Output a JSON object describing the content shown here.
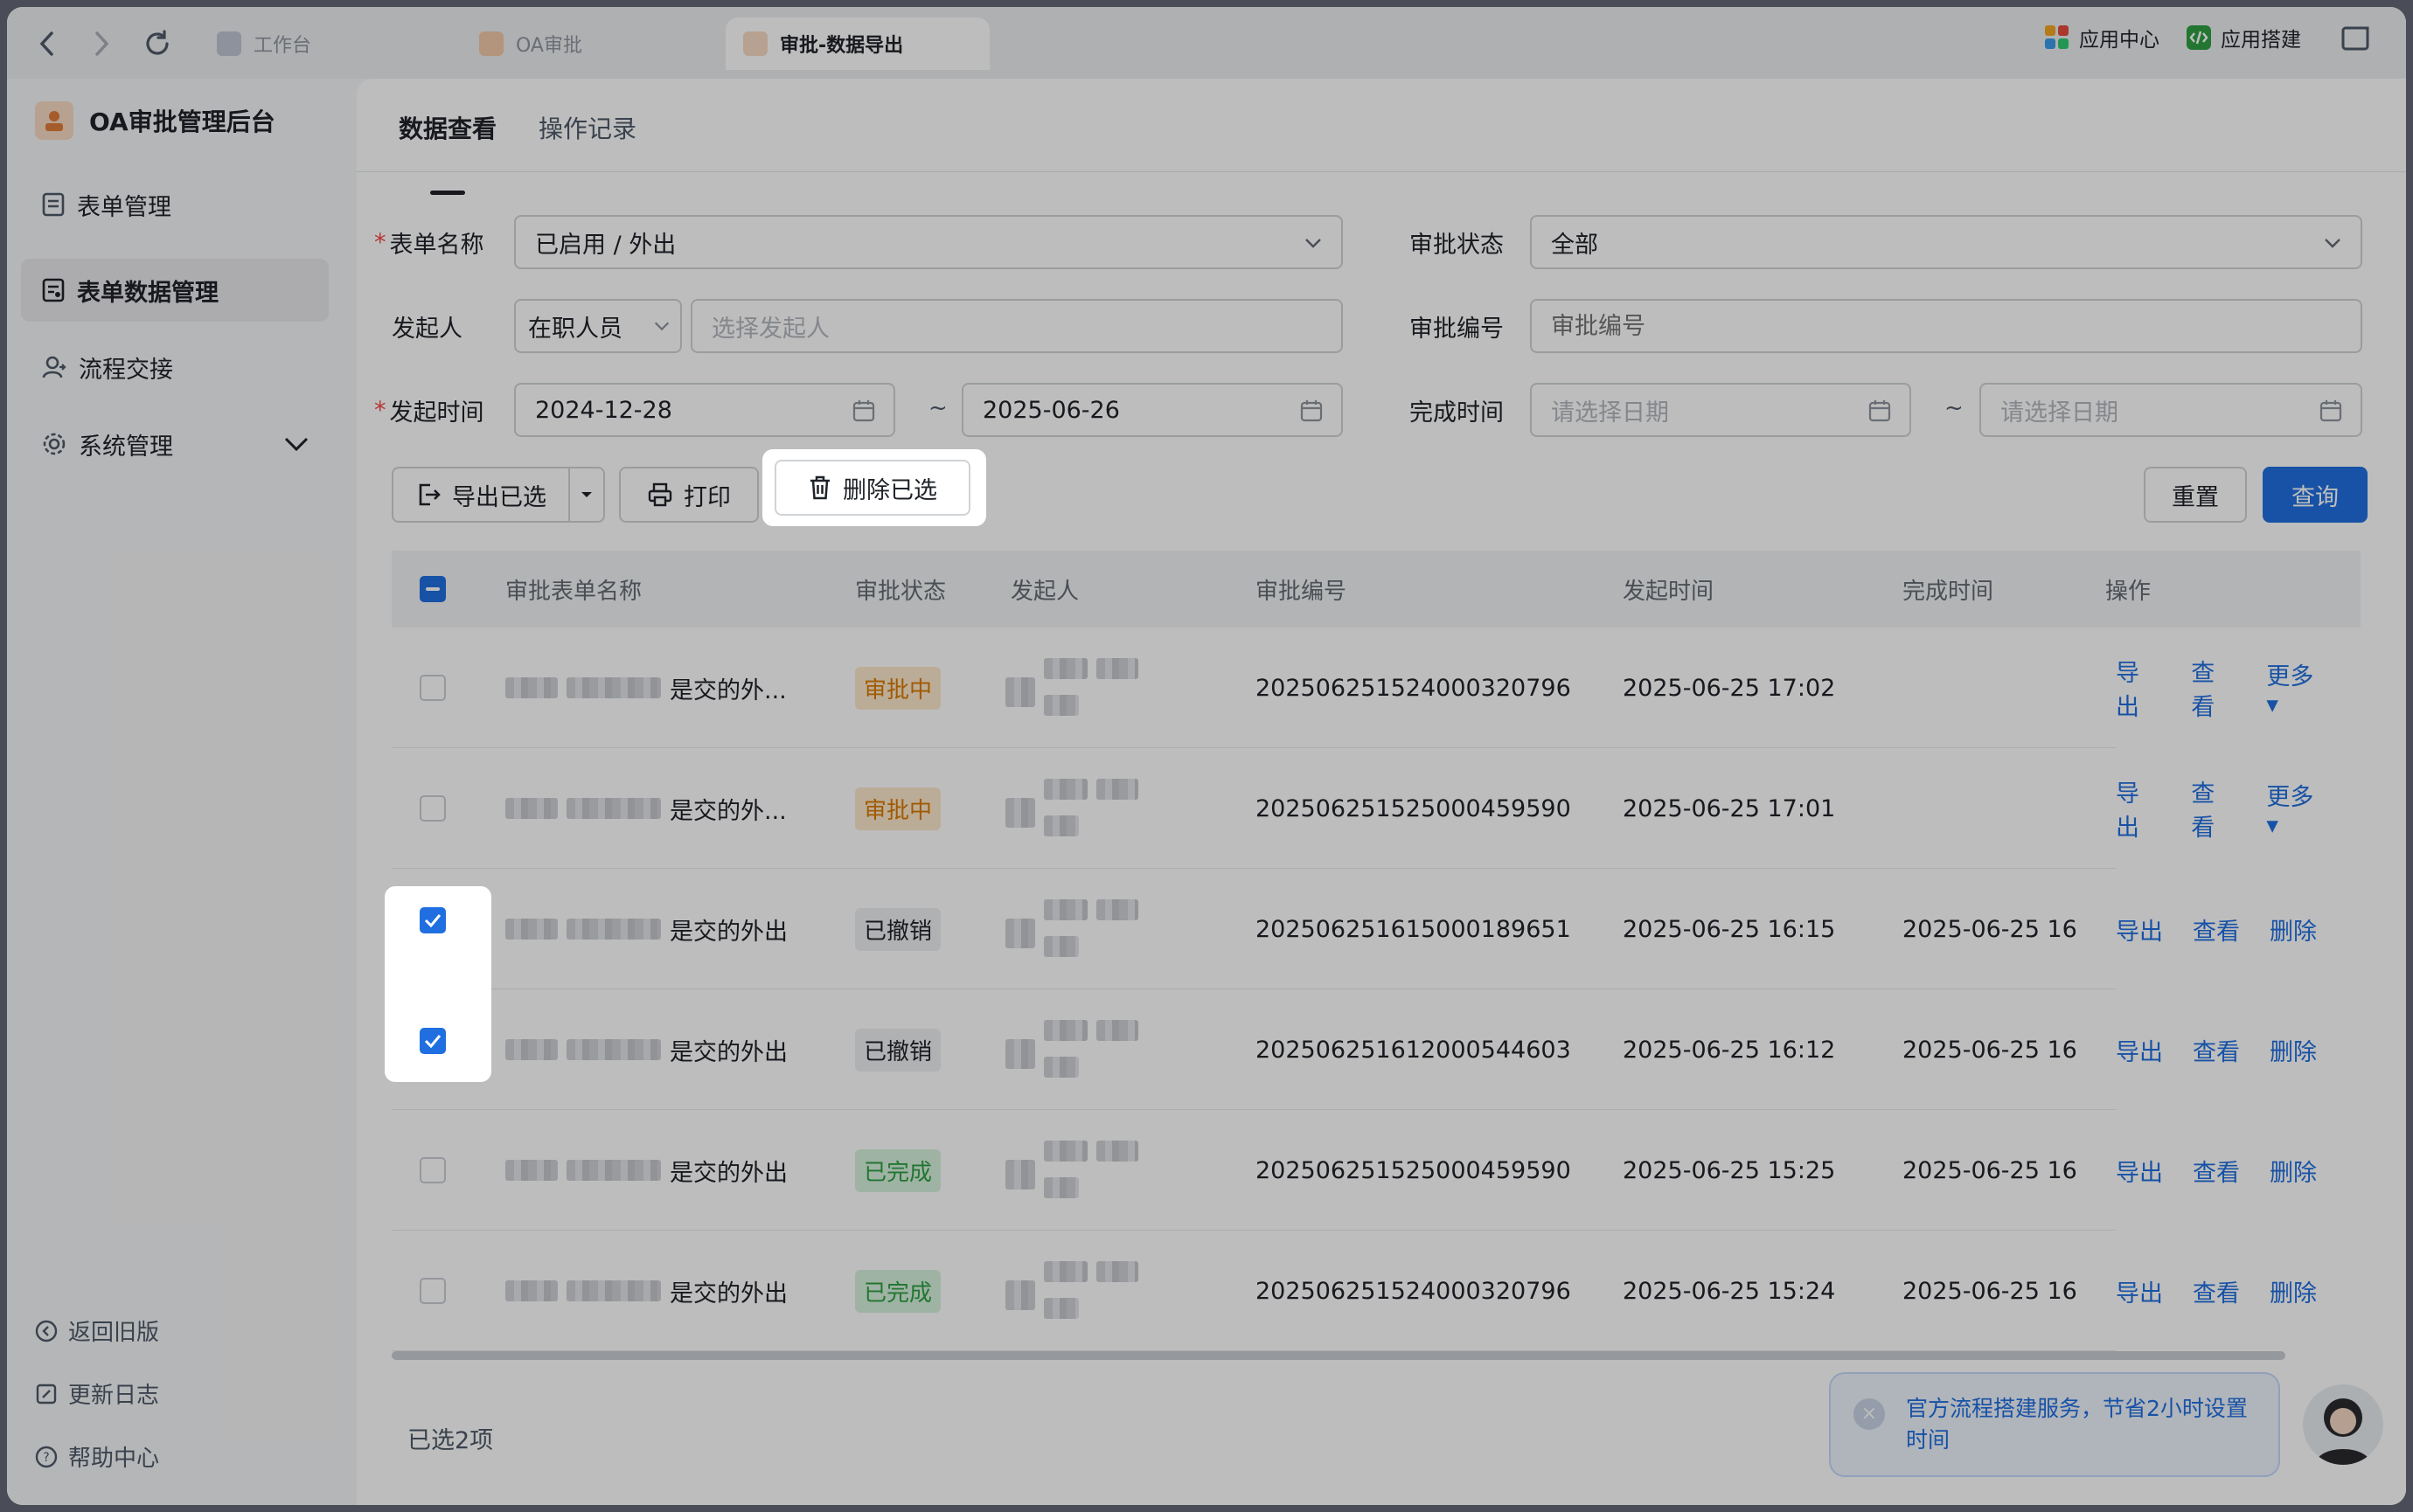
{
  "browser": {
    "tabs": [
      {
        "label": "工作台",
        "active": false
      },
      {
        "label": "OA审批",
        "active": false
      },
      {
        "label": "审批-数据导出",
        "active": true
      }
    ],
    "right_items": [
      "应用中心",
      "应用搭建"
    ]
  },
  "sidebar": {
    "title": "OA审批管理后台",
    "items": [
      {
        "label": "表单管理",
        "icon": "form-icon"
      },
      {
        "label": "表单数据管理",
        "icon": "form-data-icon",
        "active": true
      },
      {
        "label": "流程交接",
        "icon": "handover-icon"
      },
      {
        "label": "系统管理",
        "icon": "gear-icon"
      }
    ],
    "bottom": [
      {
        "label": "返回旧版",
        "icon": "back-icon"
      },
      {
        "label": "更新日志",
        "icon": "log-icon"
      },
      {
        "label": "帮助中心",
        "icon": "help-icon"
      }
    ]
  },
  "main": {
    "tabs": [
      {
        "label": "数据查看",
        "active": true
      },
      {
        "label": "操作记录",
        "active": false
      }
    ],
    "filters": {
      "form_name_label": "表单名称",
      "form_name_value": "已启用 / 外出",
      "status_label": "审批状态",
      "status_value": "全部",
      "initiator_label": "发起人",
      "initiator_type": "在职人员",
      "initiator_placeholder": "选择发起人",
      "code_label": "审批编号",
      "code_placeholder": "审批编号",
      "start_label": "发起时间",
      "start_from": "2024-12-28",
      "start_to": "2025-06-26",
      "finish_label": "完成时间",
      "finish_from_placeholder": "请选择日期",
      "finish_to_placeholder": "请选择日期",
      "tilde": "~"
    },
    "actions": {
      "export": "导出已选",
      "print": "打印",
      "delete": "删除已选",
      "reset": "重置",
      "query": "查询"
    },
    "table": {
      "headers": [
        "审批表单名称",
        "审批状态",
        "发起人",
        "审批编号",
        "发起时间",
        "完成时间",
        "操作"
      ],
      "rows": [
        {
          "name": "是交的外...",
          "status": "审批中",
          "status_type": "pending",
          "code": "20250625152400032079​6",
          "start": "2025-06-25 17:02",
          "finish": "",
          "checked": false,
          "ops": [
            "导出",
            "查看",
            "更多 ▾"
          ]
        },
        {
          "name": "是交的外...",
          "status": "审批中",
          "status_type": "pending",
          "code": "202506251525000459590",
          "start": "2025-06-25 17:01",
          "finish": "",
          "checked": false,
          "ops": [
            "导出",
            "查看",
            "更多 ▾"
          ]
        },
        {
          "name": "是交的外出",
          "status": "已撤销",
          "status_type": "revoked",
          "code": "202506251615000189651",
          "start": "2025-06-25 16:15",
          "finish": "2025-06-25 16",
          "checked": true,
          "ops": [
            "导出",
            "查看",
            "删除"
          ]
        },
        {
          "name": "是交的外出",
          "status": "已撤销",
          "status_type": "revoked",
          "code": "202506251612000544603",
          "start": "2025-06-25 16:12",
          "finish": "2025-06-25 16",
          "checked": true,
          "ops": [
            "导出",
            "查看",
            "删除"
          ]
        },
        {
          "name": "是交的外出",
          "status": "已完成",
          "status_type": "done",
          "code": "202506251525000459590",
          "start": "2025-06-25 15:25",
          "finish": "2025-06-25 16",
          "checked": false,
          "ops": [
            "导出",
            "查看",
            "删除"
          ]
        },
        {
          "name": "是交的外出",
          "status": "已完成",
          "status_type": "done",
          "code": "202506251524000320796",
          "start": "2025-06-25 15:24",
          "finish": "2025-06-25 16",
          "checked": false,
          "ops": [
            "导出",
            "查看",
            "删除"
          ]
        }
      ]
    },
    "selected_count_text": "已选2项",
    "promo": {
      "text": "官方流程搭建服务，节省2小时设置时间",
      "close": "×"
    }
  }
}
